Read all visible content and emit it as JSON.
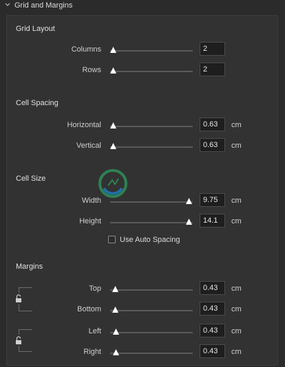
{
  "header": {
    "title": "Grid and Margins"
  },
  "grid_layout": {
    "title": "Grid Layout",
    "columns": {
      "label": "Columns",
      "value": "2"
    },
    "rows": {
      "label": "Rows",
      "value": "2"
    }
  },
  "cell_spacing": {
    "title": "Cell Spacing",
    "horizontal": {
      "label": "Horizontal",
      "value": "0.63",
      "unit": "cm"
    },
    "vertical": {
      "label": "Vertical",
      "value": "0.63",
      "unit": "cm"
    }
  },
  "cell_size": {
    "title": "Cell Size",
    "width": {
      "label": "Width",
      "value": "9.75",
      "unit": "cm"
    },
    "height": {
      "label": "Height",
      "value": "14.1",
      "unit": "cm"
    },
    "auto_spacing": {
      "label": "Use Auto Spacing",
      "checked": false
    }
  },
  "margins": {
    "title": "Margins",
    "top": {
      "label": "Top",
      "value": "0.43",
      "unit": "cm"
    },
    "bottom": {
      "label": "Bottom",
      "value": "0.43",
      "unit": "cm"
    },
    "left": {
      "label": "Left",
      "value": "0.43",
      "unit": "cm"
    },
    "right": {
      "label": "Right",
      "value": "0.43",
      "unit": "cm"
    }
  },
  "sliders": {
    "columns": 0.0,
    "rows": 0.0,
    "horizontal": 0.0,
    "vertical": 0.0,
    "width": 1.0,
    "height": 1.0,
    "top": 0.0,
    "bottom": 0.0,
    "left": 0.0,
    "right": 0.0
  },
  "icons": {
    "section_toggle": "chevron-down-icon",
    "slider_thumb": "triangle-thumb-icon",
    "lock": "unlocked-padlock-icon",
    "watermark": "logo-icon"
  },
  "colors": {
    "panel": "#323232",
    "field": "#1e1e1e",
    "track": "#5a5a5a",
    "thumb": "#ffffff"
  }
}
